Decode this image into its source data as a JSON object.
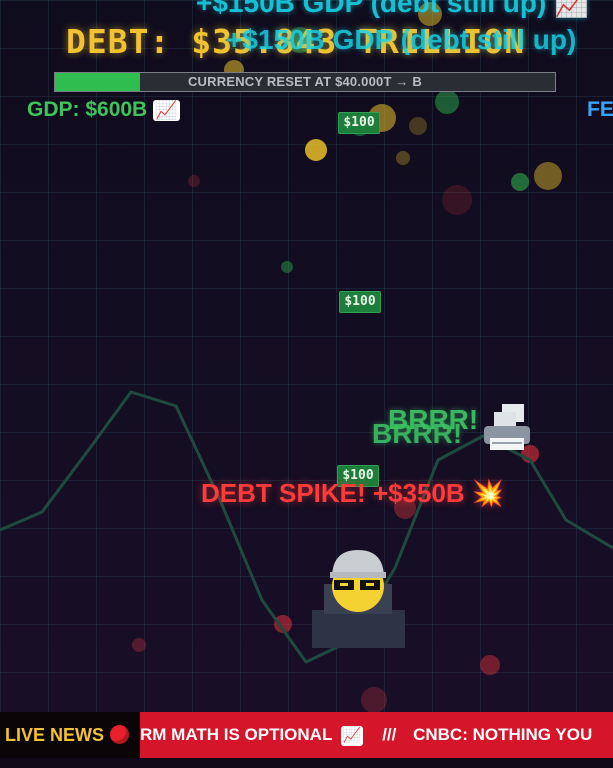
{
  "hud": {
    "debt_label": "DEBT: $35.843 TRILLION",
    "reset_label": "CURRENCY RESET AT $40.000T → B",
    "reset_progress": 0.17,
    "gdp_label": "GDP: $600B",
    "gdp_icon": "chart-increasing-icon",
    "edge_label": "FE"
  },
  "floating_text": {
    "gdp_gain_a": "+$150B GDP (debt still up) 📈",
    "gdp_gain_b": "+$150B GDP (debt still up)",
    "brrr_a": "BRRR!",
    "brrr_b": "BRRR!",
    "debt_spike": "DEBT SPIKE! +$350B 💥"
  },
  "bills": [
    "$100",
    "$100",
    "$100"
  ],
  "ticker": {
    "live_label": "LIVE NEWS",
    "headline_1": "RM MATH IS OPTIONAL",
    "separator": "///",
    "headline_2": "CNBC: NOTHING YOU"
  },
  "colors": {
    "debt": "#f2c230",
    "gdp": "#3fc35a",
    "cyan_text": "#19d3e6",
    "spike": "#ff3a3a",
    "ticker_bg": "#d4152a",
    "bill": "#1d7d3a"
  }
}
